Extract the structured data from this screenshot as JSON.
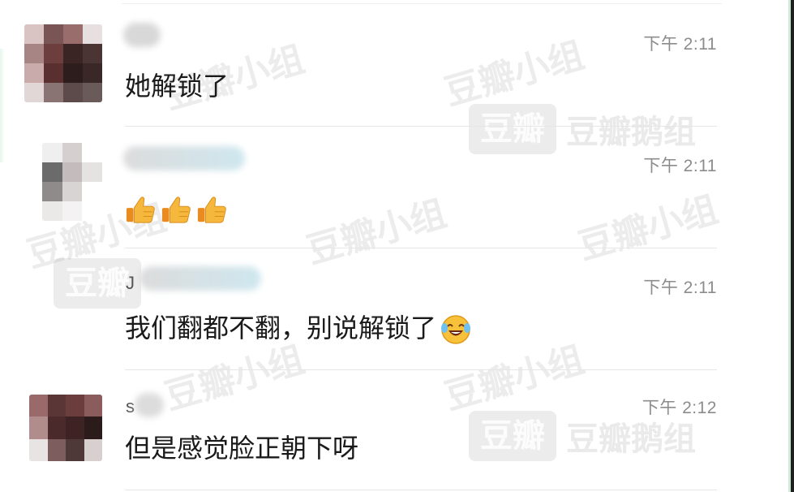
{
  "watermarks": {
    "small": "豆瓣小组",
    "badge": "豆瓣",
    "group": "豆瓣鹅组"
  },
  "messages": [
    {
      "name_initial": "",
      "time": "下午 2:11",
      "text": "她解锁了",
      "emoji": []
    },
    {
      "name_initial": "",
      "time": "下午 2:11",
      "text": "",
      "emoji": [
        "thumbs-up-icon",
        "thumbs-up-icon",
        "thumbs-up-icon"
      ]
    },
    {
      "name_initial": "J",
      "time": "下午 2:11",
      "text": "我们翻都不翻，别说解锁了",
      "emoji": [
        "laughing-crying-icon"
      ]
    },
    {
      "name_initial": "s",
      "time": "下午 2:12",
      "text": "但是感觉脸正朝下呀",
      "emoji": []
    }
  ]
}
